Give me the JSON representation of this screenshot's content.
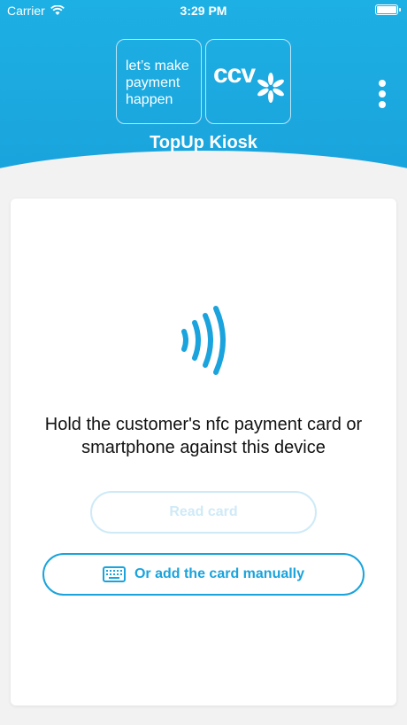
{
  "status_bar": {
    "carrier": "Carrier",
    "time": "3:29 PM"
  },
  "header": {
    "logo_text_lines": [
      "let’s make",
      "payment",
      "happen"
    ],
    "logo_brand": "ccv",
    "title": "TopUp Kiosk"
  },
  "main": {
    "icon": "nfc-icon",
    "instruction": "Hold the customer's nfc payment card or smartphone against this device",
    "read_card_label": "Read card",
    "manual_label": "Or add the card manually",
    "manual_icon": "keyboard-icon"
  },
  "colors": {
    "accent": "#1aa3dc",
    "disabled": "#cfeaf7"
  }
}
